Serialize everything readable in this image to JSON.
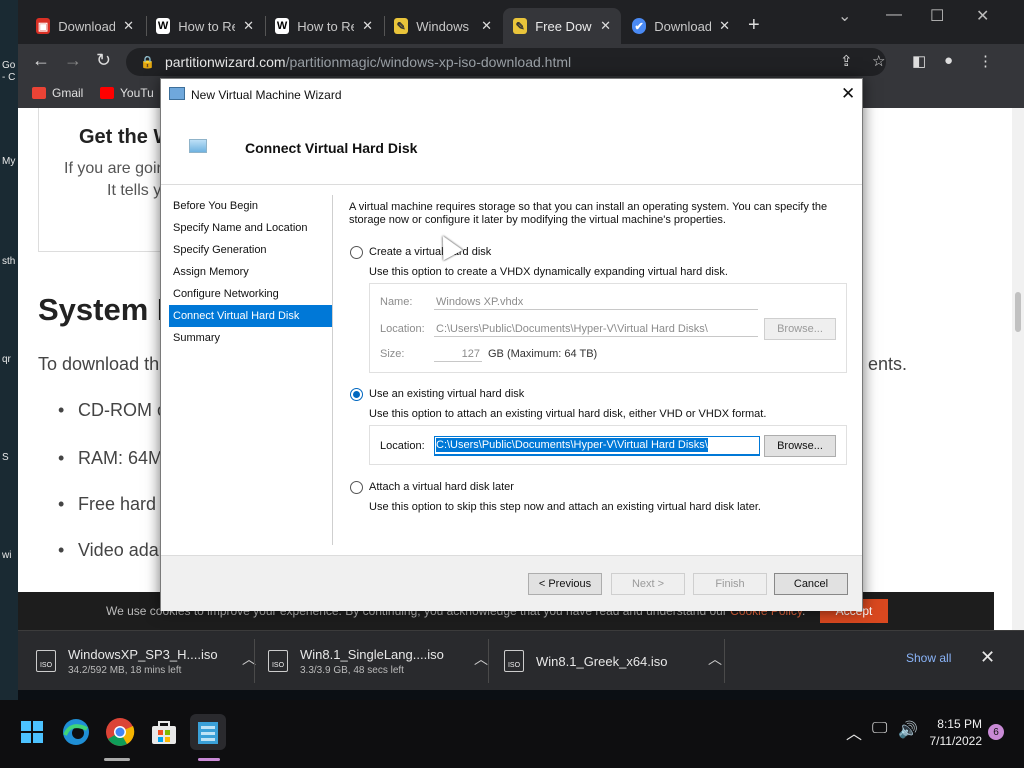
{
  "desktop": {
    "icon_labels": [
      "Go",
      "- C",
      "My",
      "sth",
      "qr",
      "S",
      "wi"
    ]
  },
  "browser": {
    "tabs": [
      {
        "title": "Download",
        "favicon": "download-favicon"
      },
      {
        "title": "How to Re",
        "favicon": "W"
      },
      {
        "title": "How to Re",
        "favicon": "W"
      },
      {
        "title": "Windows",
        "favicon": "partitionwizard-favicon"
      },
      {
        "title": "Free Dow",
        "favicon": "partitionwizard-favicon"
      },
      {
        "title": "Download",
        "favicon": "check-favicon"
      }
    ],
    "url_domain": "partitionwizard.com",
    "url_path": "/partitionmagic/windows-xp-iso-download.html",
    "bookmarks": [
      "Gmail",
      "YouTu"
    ]
  },
  "page": {
    "card_title": "Get the W",
    "card_line1": "If you are goin",
    "card_line2": "It tells y",
    "heading": "System I",
    "para_start": "To download th",
    "para_end": "ents.",
    "bullets": [
      "CD-ROM o",
      "RAM: 64M",
      "Free hard c",
      "Video adap"
    ],
    "cookie_text": "We use cookies to improve your experience. By continuing, you acknowledge that you have read and understand our",
    "cookie_link": "Cookie Policy",
    "cookie_accept": "Accept"
  },
  "downloads": {
    "items": [
      {
        "name": "WindowsXP_SP3_H....iso",
        "status": "34.2/592 MB, 18 mins left"
      },
      {
        "name": "Win8.1_SingleLang....iso",
        "status": "3.3/3.9 GB, 48 secs left"
      },
      {
        "name": "Win8.1_Greek_x64.iso",
        "status": ""
      }
    ],
    "file_icon_label": "ISO",
    "show_all": "Show all"
  },
  "taskbar": {
    "time": "8:15 PM",
    "date": "7/11/2022",
    "notifications": "6"
  },
  "wizard": {
    "title": "New Virtual Machine Wizard",
    "header": "Connect Virtual Hard Disk",
    "steps": [
      "Before You Begin",
      "Specify Name and Location",
      "Specify Generation",
      "Assign Memory",
      "Configure Networking",
      "Connect Virtual Hard Disk",
      "Summary"
    ],
    "selected_step": 5,
    "description": "A virtual machine requires storage so that you can install an operating system. You can specify the storage now or configure it later by modifying the virtual machine's properties.",
    "option_create": {
      "label": "Create a virtual hard disk",
      "help": "Use this option to create a VHDX dynamically expanding virtual hard disk.",
      "name_label": "Name:",
      "name_value": "Windows XP.vhdx",
      "location_label": "Location:",
      "location_value": "C:\\Users\\Public\\Documents\\Hyper-V\\Virtual Hard Disks\\",
      "browse": "Browse...",
      "size_label": "Size:",
      "size_value": "127",
      "size_unit": "GB (Maximum: 64 TB)"
    },
    "option_existing": {
      "label": "Use an existing virtual hard disk",
      "help": "Use this option to attach an existing virtual hard disk, either VHD or VHDX format.",
      "location_label": "Location:",
      "location_value": "C:\\Users\\Public\\Documents\\Hyper-V\\Virtual Hard Disks\\",
      "browse": "Browse..."
    },
    "option_later": {
      "label": "Attach a virtual hard disk later",
      "help": "Use this option to skip this step now and attach an existing virtual hard disk later."
    },
    "buttons": {
      "previous": "< Previous",
      "next": "Next >",
      "finish": "Finish",
      "cancel": "Cancel"
    }
  },
  "colors": {
    "accent": "#0078d7",
    "chrome_dark": "#202124",
    "cookie_accept": "#d9481f"
  }
}
